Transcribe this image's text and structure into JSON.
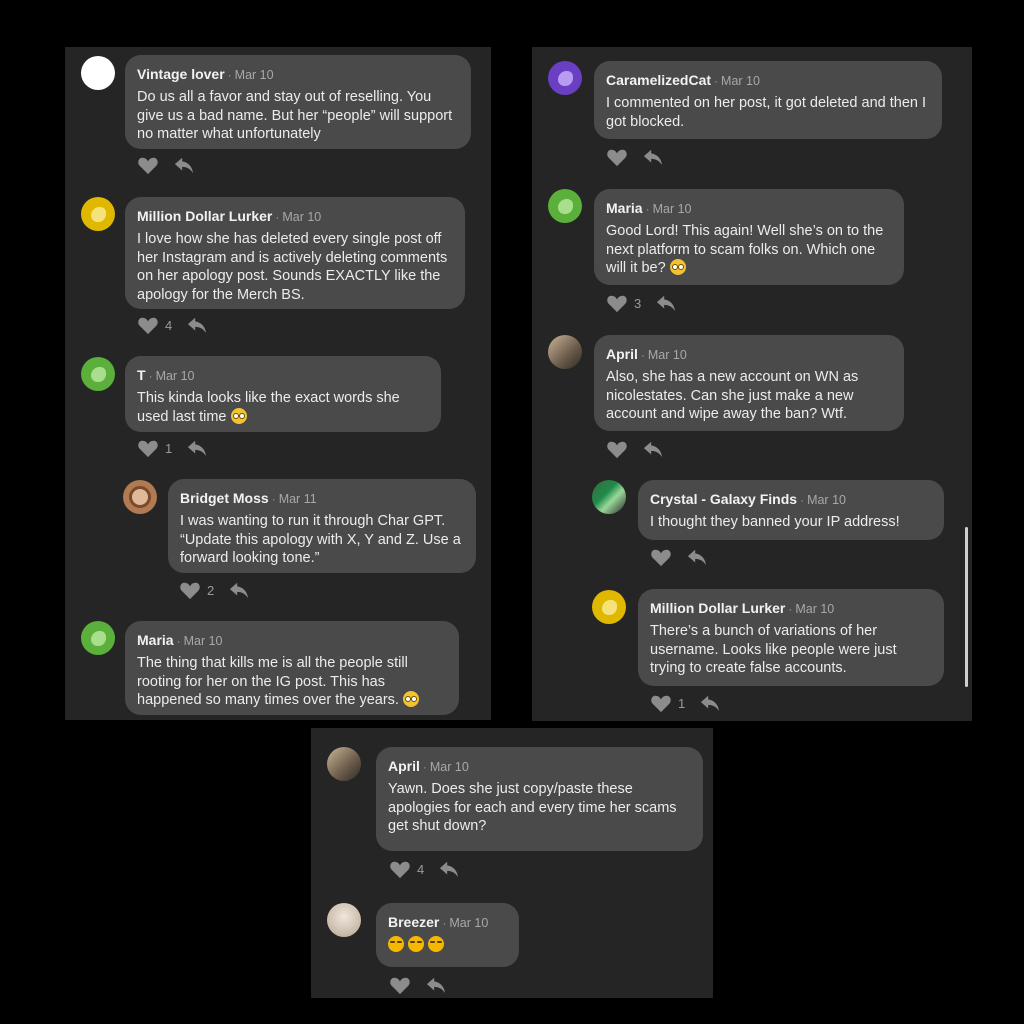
{
  "panel_left": {
    "comments": [
      {
        "name": "Vintage lover",
        "date": "Mar 10",
        "body": "Do us all a favor and stay out of reselling. You give us a bad name. But her “people” will support no matter what unfortunately",
        "likes": ""
      },
      {
        "name": "Million Dollar Lurker",
        "date": "Mar 10",
        "body": "I love how she has deleted every single post off her Instagram and is actively deleting comments on her apology post. Sounds EXACTLY like the apology for the Merch BS.",
        "likes": "4"
      },
      {
        "name": "T",
        "date": "Mar 10",
        "body": "This kinda looks like the exact words she used last time",
        "likes": "1"
      },
      {
        "name": "Bridget Moss",
        "date": "Mar 11",
        "body": "I was wanting to run it through Char GPT.  “Update this apology with X, Y and Z. Use a forward looking tone.”",
        "likes": "2"
      },
      {
        "name": "Maria",
        "date": "Mar 10",
        "body": "The thing that kills me is all the people still rooting for her on the IG post. This has happened so many times over the years.",
        "likes": ""
      }
    ]
  },
  "panel_right": {
    "comments": [
      {
        "name": "CaramelizedCat",
        "date": "Mar 10",
        "body": "I commented on her post, it got deleted and then I got blocked.",
        "likes": ""
      },
      {
        "name": "Maria",
        "date": "Mar 10",
        "body": "Good Lord! This again! Well she’s on to the next platform to scam folks on. Which one  will it be?",
        "likes": "3"
      },
      {
        "name": "April",
        "date": "Mar 10",
        "body": "Also, she has a new account on WN as nicolestates. Can she just make a new account and wipe away the ban? Wtf.",
        "likes": ""
      },
      {
        "name": "Crystal - Galaxy Finds",
        "date": "Mar 10",
        "body": "I thought they banned your IP address!",
        "likes": ""
      },
      {
        "name": "Million Dollar Lurker",
        "date": "Mar 10",
        "body": "There’s a bunch of variations of her username. Looks like people were just trying to create false accounts.",
        "likes": "1"
      }
    ]
  },
  "panel_bottom": {
    "comments": [
      {
        "name": "April",
        "date": "Mar 10",
        "body": "Yawn. Does she just copy/paste these apologies for each and every time her scams get shut down?",
        "likes": "4"
      },
      {
        "name": "Breezer",
        "date": "Mar 10",
        "body": "",
        "likes": ""
      }
    ]
  },
  "separator": "·",
  "colors": {
    "panel": "#252525",
    "bubble": "#4a4a4a",
    "yellow": "#e0b800",
    "green": "#5ab03a",
    "purple": "#6a3fc4"
  }
}
